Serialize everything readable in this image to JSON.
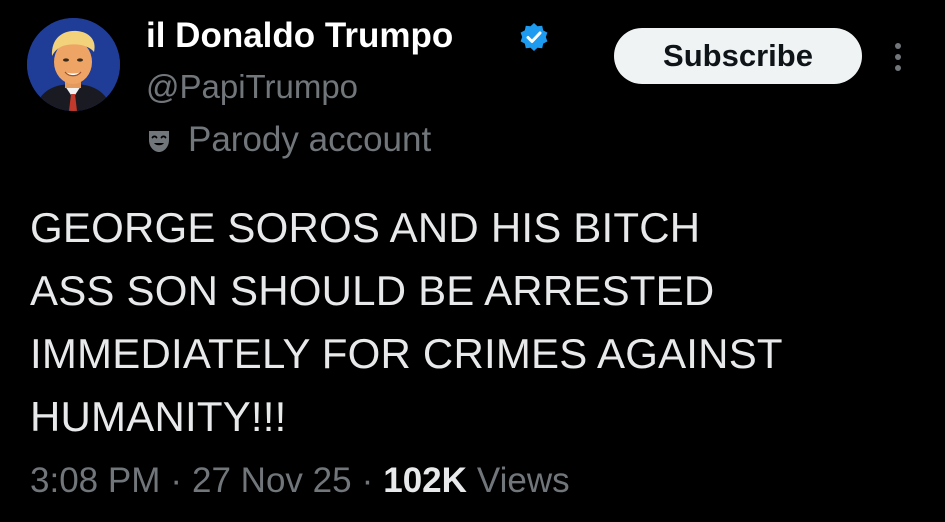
{
  "author": {
    "display_name": "il Donaldo Trumpo",
    "handle": "@PapiTrumpo",
    "verified": true,
    "label_icon": "parody-mask-icon",
    "label": "Parody account"
  },
  "actions": {
    "subscribe_label": "Subscribe",
    "more_icon": "more-vertical-icon"
  },
  "tweet": {
    "text": "GEORGE SOROS AND HIS BITCH\nASS SON SHOULD BE ARRESTED\nIMMEDIATELY FOR CRIMES AGAINST\nHUMANITY!!!"
  },
  "meta": {
    "time": "3:08 PM",
    "separator": "·",
    "date": "27 Nov 25",
    "views_count": "102K",
    "views_label": "Views"
  },
  "colors": {
    "background": "#000000",
    "text_primary": "#e7e9ea",
    "text_secondary": "#71767b",
    "verified_blue": "#1d9bf0",
    "button_bg": "#eff3f4"
  }
}
